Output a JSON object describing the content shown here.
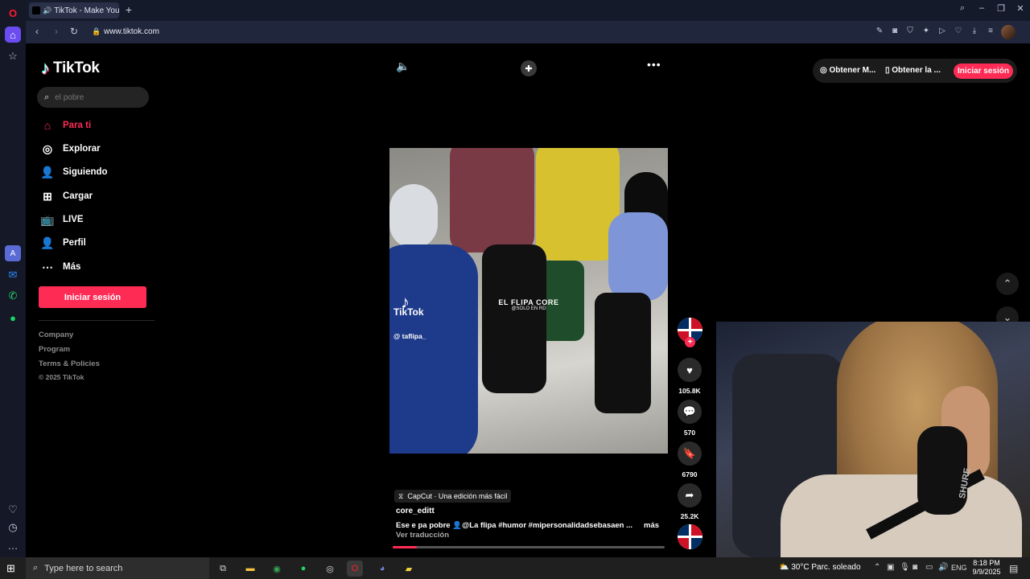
{
  "browser": {
    "tab_title": "TikTok - Make Your Day",
    "url": "www.tiktok.com"
  },
  "tiktok": {
    "logo_text": "TikTok",
    "search_placeholder": "el pobre",
    "nav": [
      {
        "label": "Para ti",
        "icon": "home-icon",
        "active": true
      },
      {
        "label": "Explorar",
        "icon": "compass-icon"
      },
      {
        "label": "Siguiendo",
        "icon": "following-icon"
      },
      {
        "label": "Cargar",
        "icon": "upload-icon"
      },
      {
        "label": "LIVE",
        "icon": "live-icon"
      },
      {
        "label": "Perfil",
        "icon": "profile-icon"
      },
      {
        "label": "Más",
        "icon": "more-dots-icon"
      }
    ],
    "login_button": "Iniciar sesión",
    "footer": [
      "Company",
      "Program",
      "Terms & Policies",
      "© 2025 TikTok"
    ],
    "top_bar": {
      "get_coins": "Obtener M...",
      "get_app": "Obtener la ...",
      "login": "Iniciar sesión"
    },
    "video": {
      "watermark_brand": "TikTok",
      "watermark_handle": "@ taflipa_",
      "center_text": "EL FLIPA CORE",
      "center_sub": "@SOLO EN RD",
      "progress_percent": 9
    },
    "actions": {
      "likes": "105.8K",
      "comments": "570",
      "saves": "6790",
      "shares": "25.2K"
    },
    "caption": {
      "capcut": "CapCut · Una edición más fácil",
      "author": "core_editt",
      "description": "Ese e pa pobre 👤@La flipa  #humor  #mipersonalidadsebasaen ...",
      "more": "más",
      "translate": "Ver traducción"
    },
    "webcam": {
      "mic_brand": "SHURE"
    }
  },
  "taskbar": {
    "search_placeholder": "Type here to search",
    "weather": "30°C  Parc. soleado",
    "lang": "ENG",
    "time": "8:18 PM",
    "date": "9/9/2025"
  },
  "colors": {
    "accent": "#fe2c55",
    "background": "#000000",
    "browser_chrome": "#20263b"
  }
}
